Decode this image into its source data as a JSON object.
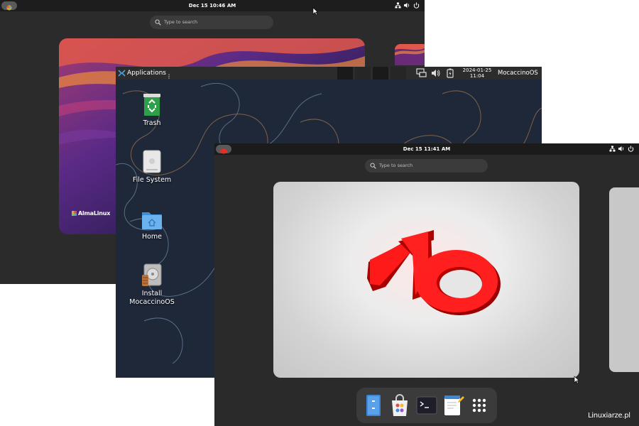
{
  "screen1": {
    "clock": "Dec 15  10:46 AM",
    "search_placeholder": "Type to search",
    "brand": "AlmaLinux"
  },
  "screen2": {
    "applications_label": "Applications",
    "date": "2024-01-25",
    "time": "11:04",
    "user": "MocaccinoOS",
    "desktop_icons": {
      "trash": "Trash",
      "filesystem": "File System",
      "home": "Home",
      "install_line1": "Install",
      "install_line2": "MocaccinoOS"
    }
  },
  "screen3": {
    "clock": "Dec 15  11:41 AM",
    "search_placeholder": "Type to search",
    "watermark": "Linuxiarze.pl",
    "dock_items": [
      "files-icon",
      "software-icon",
      "terminal-icon",
      "text-editor-icon",
      "app-grid-icon"
    ]
  }
}
